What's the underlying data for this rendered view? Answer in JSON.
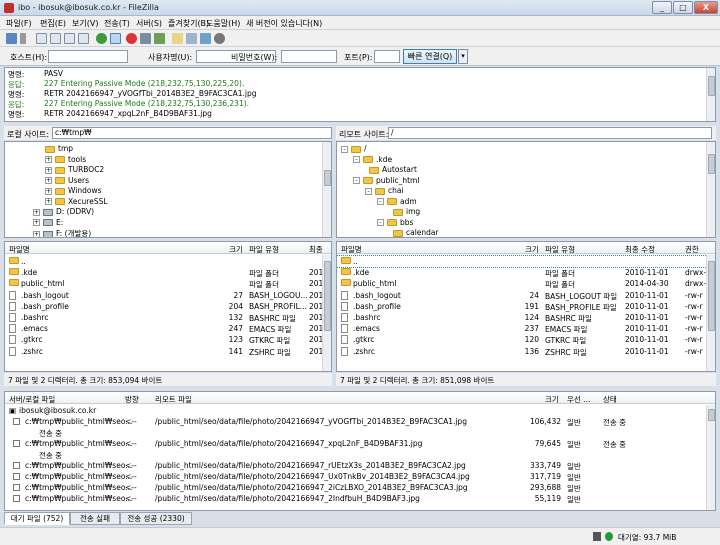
{
  "window": {
    "title": "ibo - ibosuk@ibosuk.co.kr - FileZilla",
    "minimize": "_",
    "maximize": "□",
    "close": "X"
  },
  "menu": [
    "파일(F)",
    "편집(E)",
    "보기(V)",
    "전송(T)",
    "서버(S)",
    "즐겨찾기(B)",
    "도움말(H)",
    "새 버전이 있습니다(N)"
  ],
  "quick": {
    "host_label": "호스트(H):",
    "user_label": "사용자명(U):",
    "pass_label": "비밀번호(W):",
    "port_label": "포트(P):",
    "connect": "빠른 연결(Q)",
    "dropdown": "▾"
  },
  "log": [
    {
      "label": "명령:",
      "msg": "PASV",
      "type": "cmd"
    },
    {
      "label": "응답:",
      "msg": "227 Entering Passive Mode (218,232,75,130,225,20).",
      "type": "ok"
    },
    {
      "label": "명령:",
      "msg": "RETR 2042166947_yVOGfTbi_2014B3E2_B9FAC3CA1.jpg",
      "type": "cmd"
    },
    {
      "label": "응답:",
      "msg": "227 Entering Passive Mode (218,232,75,130,236,231).",
      "type": "ok"
    },
    {
      "label": "명령:",
      "msg": "RETR 2042166947_xpqL2nF_B4D9BAF31.jpg",
      "type": "cmd"
    }
  ],
  "local": {
    "site_label": "로컬 사이트:",
    "path": "c:₩tmp₩",
    "tree": [
      {
        "name": "tmp",
        "indent": 40,
        "icon": "folder",
        "exp": ""
      },
      {
        "name": "tools",
        "indent": 40,
        "icon": "folder",
        "exp": "+"
      },
      {
        "name": "TURBOC2",
        "indent": 40,
        "icon": "folder",
        "exp": "+"
      },
      {
        "name": "Users",
        "indent": 40,
        "icon": "folder",
        "exp": "+"
      },
      {
        "name": "Windows",
        "indent": 40,
        "icon": "folder",
        "exp": "+"
      },
      {
        "name": "XecureSSL",
        "indent": 40,
        "icon": "folder",
        "exp": "+"
      },
      {
        "name": "D: (DDRV)",
        "indent": 28,
        "icon": "drive",
        "exp": "+"
      },
      {
        "name": "E:",
        "indent": 28,
        "icon": "drive",
        "exp": "+"
      },
      {
        "name": "F: (개발용)",
        "indent": 28,
        "icon": "drive",
        "exp": "+"
      }
    ],
    "cols": {
      "name": "파일명",
      "size": "크기",
      "type": "파일 유형",
      "mod": "최종"
    },
    "files": [
      {
        "name": "..",
        "size": "",
        "type": "",
        "mod": "",
        "icon": "folder"
      },
      {
        "name": ".kde",
        "size": "",
        "type": "파일 폴더",
        "mod": "201",
        "icon": "folder"
      },
      {
        "name": "public_html",
        "size": "",
        "type": "파일 폴더",
        "mod": "201",
        "icon": "folder"
      },
      {
        "name": ".bash_logout",
        "size": "27",
        "type": "BASH_LOGOU...",
        "mod": "201",
        "icon": "file"
      },
      {
        "name": ".bash_profile",
        "size": "204",
        "type": "BASH_PROFIL...",
        "mod": "201",
        "icon": "file"
      },
      {
        "name": ".bashrc",
        "size": "132",
        "type": "BASHRC 파일",
        "mod": "201",
        "icon": "file"
      },
      {
        "name": ".emacs",
        "size": "247",
        "type": "EMACS 파일",
        "mod": "201",
        "icon": "file"
      },
      {
        "name": ".gtkrc",
        "size": "123",
        "type": "GTKRC 파일",
        "mod": "201",
        "icon": "file"
      },
      {
        "name": ".zshrc",
        "size": "141",
        "type": "ZSHRC 파일",
        "mod": "201",
        "icon": "file"
      }
    ],
    "status": "7 파일 및 2 디렉터리. 총 크기: 853,094 바이트"
  },
  "remote": {
    "site_label": "리모트 사이트:",
    "path": "/",
    "tree": [
      {
        "name": "/",
        "indent": 4,
        "icon": "folder",
        "exp": "-"
      },
      {
        "name": ".kde",
        "indent": 16,
        "icon": "folder",
        "exp": "-"
      },
      {
        "name": "Autostart",
        "indent": 32,
        "icon": "folder",
        "exp": ""
      },
      {
        "name": "public_html",
        "indent": 16,
        "icon": "folder",
        "exp": "-"
      },
      {
        "name": "chai",
        "indent": 28,
        "icon": "folder",
        "exp": "-"
      },
      {
        "name": "adm",
        "indent": 40,
        "icon": "folder",
        "exp": "-"
      },
      {
        "name": "img",
        "indent": 56,
        "icon": "folder",
        "exp": ""
      },
      {
        "name": "bbs",
        "indent": 40,
        "icon": "folder",
        "exp": "-"
      },
      {
        "name": "calendar",
        "indent": 56,
        "icon": "folder",
        "exp": ""
      }
    ],
    "cols": {
      "name": "파일명",
      "size": "크기",
      "type": "파일 유형",
      "mod": "최종 수정",
      "perm": "권한"
    },
    "files": [
      {
        "name": "..",
        "size": "",
        "type": "",
        "mod": "",
        "perm": "",
        "icon": "folder"
      },
      {
        "name": ".kde",
        "size": "",
        "type": "파일 폴더",
        "mod": "2010-11-01",
        "perm": "drwx-",
        "icon": "folder"
      },
      {
        "name": "public_html",
        "size": "",
        "type": "파일 폴더",
        "mod": "2014-04-30",
        "perm": "drwx-",
        "icon": "folder"
      },
      {
        "name": ".bash_logout",
        "size": "24",
        "type": "BASH_LOGOUT 파일",
        "mod": "2010-11-01",
        "perm": "-rw-r",
        "icon": "file"
      },
      {
        "name": ".bash_profile",
        "size": "191",
        "type": "BASH_PROFILE 파일",
        "mod": "2010-11-01",
        "perm": "-rw-r",
        "icon": "file"
      },
      {
        "name": ".bashrc",
        "size": "124",
        "type": "BASHRC 파일",
        "mod": "2010-11-01",
        "perm": "-rw-r",
        "icon": "file"
      },
      {
        "name": ".emacs",
        "size": "237",
        "type": "EMACS 파일",
        "mod": "2010-11-01",
        "perm": "-rw-r",
        "icon": "file"
      },
      {
        "name": ".gtkrc",
        "size": "120",
        "type": "GTKRC 파일",
        "mod": "2010-11-01",
        "perm": "-rw-r",
        "icon": "file"
      },
      {
        "name": ".zshrc",
        "size": "136",
        "type": "ZSHRC 파일",
        "mod": "2010-11-01",
        "perm": "-rw-r",
        "icon": "file"
      }
    ],
    "status": "7 파일 및 2 디렉터리. 총 크기: 851,098 바이트"
  },
  "queue": {
    "cols": {
      "local": "서버/로컬 파일",
      "dir": "방향",
      "remote": "리모트 파일",
      "size": "크기",
      "priority": "우선 ...",
      "status": "상태"
    },
    "server": "ibosuk@ibosuk.co.kr",
    "items": [
      {
        "local": "c:₩tmp₩public_html₩seo...",
        "dir": "<--",
        "remote": "/public_html/seo/data/file/photo/2042166947_yVOGfTbi_2014B3E2_B9FAC3CA1.jpg",
        "size": "106,432",
        "priority": "일반",
        "status": "전송 중",
        "sub": "전송 중"
      },
      {
        "local": "c:₩tmp₩public_html₩seo...",
        "dir": "<--",
        "remote": "/public_html/seo/data/file/photo/2042166947_xpqL2nF_B4D9BAF31.jpg",
        "size": "79,645",
        "priority": "일반",
        "status": "전송 중",
        "sub": "전송 중"
      },
      {
        "local": "c:₩tmp₩public_html₩seo...",
        "dir": "<--",
        "remote": "/public_html/seo/data/file/photo/2042166947_rUEtzX3s_2014B3E2_B9FAC3CA2.jpg",
        "size": "333,749",
        "priority": "일반",
        "status": "",
        "sub": ""
      },
      {
        "local": "c:₩tmp₩public_html₩seo...",
        "dir": "<--",
        "remote": "/public_html/seo/data/file/photo/2042166947_Ux0TnkBv_2014B3E2_B9FAC3CA4.jpg",
        "size": "317,719",
        "priority": "일반",
        "status": "",
        "sub": ""
      },
      {
        "local": "c:₩tmp₩public_html₩seo...",
        "dir": "<--",
        "remote": "/public_html/seo/data/file/photo/2042166947_2iCzLBXO_2014B3E2_B9FAC3CA3.jpg",
        "size": "293,688",
        "priority": "일반",
        "status": "",
        "sub": ""
      },
      {
        "local": "c:₩tmp₩public_html₩seo...",
        "dir": "<--",
        "remote": "/public_html/seo/data/file/photo/2042166947_2IndfbuH_B4D9BAF3.jpg",
        "size": "55,119",
        "priority": "일반",
        "status": "",
        "sub": ""
      }
    ]
  },
  "tabs": [
    "대기 파일 (752)",
    "전송 실패",
    "전송 성공 (2330)"
  ],
  "statusbar": {
    "queue": "대기열: 93.7 MiB"
  },
  "colors": {
    "accent": "#3c7fb1",
    "ok_text": "#1c7a1c",
    "folder": "#f0c54b"
  }
}
